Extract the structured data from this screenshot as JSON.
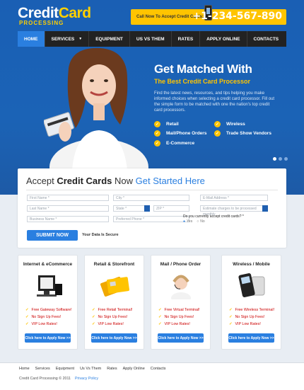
{
  "header": {
    "logo_credit": "Credit",
    "logo_card": "Card",
    "logo_sub": "PROCESSING",
    "call_label": "Call Now To Accept Credit Cards:",
    "phone": "+1-234-567-890"
  },
  "nav": {
    "items": [
      {
        "label": "HOME"
      },
      {
        "label": "SERVICES"
      },
      {
        "label": "EQUIPMENT"
      },
      {
        "label": "US VS THEM"
      },
      {
        "label": "RATES"
      },
      {
        "label": "APPLY ONLINE"
      },
      {
        "label": "CONTACTS"
      }
    ]
  },
  "hero": {
    "title": "Get Matched With",
    "subtitle": "The Best Credit Card Processor",
    "text": "Find the latest news, resources, and tips helping you make informed choices when selecting a credit card processor. Fill out the simple form to be matched with one the nation's top credit card processors.",
    "features": [
      "Retail",
      "Wireless",
      "Mail/Phone Orders",
      "Trade Show Vendors",
      "E-Commerce"
    ]
  },
  "form": {
    "title_a": "Accept ",
    "title_b": "Credit Cards",
    "title_c": " Now ",
    "title_d": "Get Started Here",
    "placeholders": {
      "first_name": "First Name *",
      "city": "City *",
      "email": "E-Mail Address *",
      "last_name": "Last Name *",
      "state": "State *",
      "zip": "ZIP *",
      "monthly": "Estimate charges to be processed monthly",
      "business": "Business Name *",
      "phone": "Preferred Phone *"
    },
    "question": "Do you currently accept credit cards? *",
    "radio_yes": "Yes",
    "radio_no": "No",
    "submit": "SUBMIT NOW",
    "secure": "Your Data Is Secure"
  },
  "boxes": [
    {
      "title": "Internet & eCommerce",
      "items": [
        "Free Gateway Software!",
        "No Sign Up Fees!",
        "VIP Low Rates!"
      ],
      "button": "Click here to Apply Now >>"
    },
    {
      "title": "Retail & Storefront",
      "items": [
        "Free Retail Terminal!",
        "No Sign Up Fees!",
        "VIP Low Rates!"
      ],
      "button": "Click here to Apply Now >>"
    },
    {
      "title": "Mail / Phone Order",
      "items": [
        "Free Virtual Terminal!",
        "No Sign Up Fees!",
        "VIP Low Rates!"
      ],
      "button": "Click here to Apply Now >>"
    },
    {
      "title": "Wireless / Mobile",
      "items": [
        "Free Wireless Terminal!",
        "No Sign Up Fees!",
        "VIP Low Rates!"
      ],
      "button": "Click here to Apply Now >>"
    }
  ],
  "footer": {
    "links": [
      "Home",
      "Services",
      "Equipment",
      "Us Vs Them",
      "Rates",
      "Apply Online",
      "Contacts"
    ],
    "copyright": "Credit Card Processing © 2011",
    "privacy": "Privacy Policy"
  },
  "colors": {
    "accent": "#2a7fe0",
    "yellow": "#ffc400",
    "nav": "#222222"
  },
  "icons": [
    "phone-icon",
    "check-icon"
  ]
}
